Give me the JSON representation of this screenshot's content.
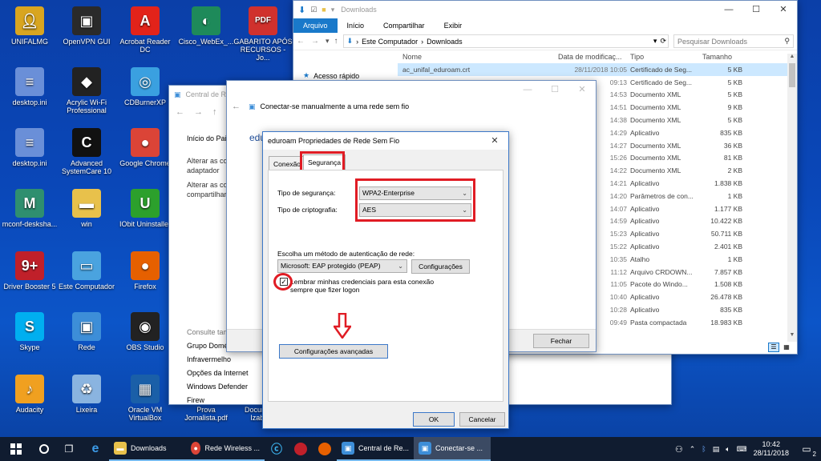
{
  "desktop_icons": [
    {
      "label": "UNIFALMG",
      "icon": "user-folder-icon",
      "color": "#d8a520"
    },
    {
      "label": "OpenVPN GUI",
      "icon": "openvpn-icon",
      "color": "#2a2a2a"
    },
    {
      "label": "Acrobat Reader DC",
      "icon": "acrobat-icon",
      "color": "#e2231a"
    },
    {
      "label": "Cisco_WebEx_...",
      "icon": "webex-icon",
      "color": "#1e8a5a"
    },
    {
      "label": "GABARITO APÓS RECURSOS - Jo...",
      "icon": "pdf-file-icon",
      "color": "#d0312d"
    },
    {
      "label": "desktop.ini",
      "icon": "ini-file-icon",
      "color": "#6a8fd8"
    },
    {
      "label": "Acrylic Wi-Fi Professional",
      "icon": "acrylic-wifi-icon",
      "color": "#222"
    },
    {
      "label": "CDBurnerXP",
      "icon": "cdburner-icon",
      "color": "#3aa0e0"
    },
    {
      "label": "desktop.ini",
      "icon": "ini-file-icon",
      "color": "#6a8fd8"
    },
    {
      "label": "Advanced SystemCare 10",
      "icon": "systemcare-icon",
      "color": "#111"
    },
    {
      "label": "Google Chrome",
      "icon": "chrome-icon",
      "color": "#db4437"
    },
    {
      "label": "mconf-desksha...",
      "icon": "mconf-icon",
      "color": "#2f8f6f"
    },
    {
      "label": "win",
      "icon": "folder-icon",
      "color": "#e8c14b"
    },
    {
      "label": "IObit Uninstaller",
      "icon": "iobit-icon",
      "color": "#2ca02c"
    },
    {
      "label": "Driver Booster 5",
      "icon": "driver-booster-icon",
      "color": "#c0202a"
    },
    {
      "label": "Este Computador",
      "icon": "computer-icon",
      "color": "#4aa3df"
    },
    {
      "label": "Firefox",
      "icon": "firefox-icon",
      "color": "#e66000"
    },
    {
      "label": "Skype",
      "icon": "skype-icon",
      "color": "#00aff0"
    },
    {
      "label": "Rede",
      "icon": "network-icon",
      "color": "#3d8ed8"
    },
    {
      "label": "OBS Studio",
      "icon": "obs-icon",
      "color": "#222"
    },
    {
      "label": "Audacity",
      "icon": "audacity-icon",
      "color": "#f0a020"
    },
    {
      "label": "Lixeira",
      "icon": "recycle-bin-icon",
      "color": "#8ab4e0"
    },
    {
      "label": "Oracle VM VirtualBox",
      "icon": "virtualbox-icon",
      "color": "#1a5fa8"
    },
    {
      "label": "Prova Jornalista.pdf",
      "icon": "pdf-file-icon",
      "color": "#d0312d"
    },
    {
      "label": "Documento Izabel...",
      "icon": "document-icon",
      "color": "#ddd"
    }
  ],
  "explorer": {
    "title": "Downloads",
    "tabs": [
      "Arquivo",
      "Início",
      "Compartilhar",
      "Exibir"
    ],
    "path": [
      "Este Computador",
      "Downloads"
    ],
    "search_placeholder": "Pesquisar Downloads",
    "columns": [
      "Nome",
      "Data de modificaç...",
      "Tipo",
      "Tamanho"
    ],
    "nav_quick_access": "Acesso rápido",
    "rows": [
      {
        "name": "ac_unifal_eduroam.crt",
        "date": "28/11/2018 10:05",
        "type": "Certificado de Seg...",
        "size": "5 KB"
      },
      {
        "name": "",
        "date": "09:13",
        "type": "Certificado de Seg...",
        "size": "5 KB"
      },
      {
        "name": "",
        "date": "14:53",
        "type": "Documento XML",
        "size": "5 KB"
      },
      {
        "name": "",
        "date": "14:51",
        "type": "Documento XML",
        "size": "9 KB"
      },
      {
        "name": "",
        "date": "14:38",
        "type": "Documento XML",
        "size": "5 KB"
      },
      {
        "name": "",
        "date": "14:29",
        "type": "Aplicativo",
        "size": "835 KB"
      },
      {
        "name": "",
        "date": "14:27",
        "type": "Documento XML",
        "size": "36 KB"
      },
      {
        "name": "",
        "date": "15:26",
        "type": "Documento XML",
        "size": "81 KB"
      },
      {
        "name": "",
        "date": "14:22",
        "type": "Documento XML",
        "size": "2 KB"
      },
      {
        "name": "",
        "date": "14:21",
        "type": "Aplicativo",
        "size": "1.838 KB"
      },
      {
        "name": "",
        "date": "14:20",
        "type": "Parâmetros de con...",
        "size": "1 KB"
      },
      {
        "name": "",
        "date": "14:07",
        "type": "Aplicativo",
        "size": "1.177 KB"
      },
      {
        "name": "",
        "date": "14:59",
        "type": "Aplicativo",
        "size": "10.422 KB"
      },
      {
        "name": "",
        "date": "15:23",
        "type": "Aplicativo",
        "size": "50.711 KB"
      },
      {
        "name": "",
        "date": "15:22",
        "type": "Aplicativo",
        "size": "2.401 KB"
      },
      {
        "name": "",
        "date": "10:35",
        "type": "Atalho",
        "size": "1 KB"
      },
      {
        "name": "",
        "date": "11:12",
        "type": "Arquivo CRDOWN...",
        "size": "7.857 KB"
      },
      {
        "name": "",
        "date": "11:05",
        "type": "Pacote do Windo...",
        "size": "1.508 KB"
      },
      {
        "name": "",
        "date": "10:40",
        "type": "Aplicativo",
        "size": "26.478 KB"
      },
      {
        "name": "",
        "date": "10:28",
        "type": "Aplicativo",
        "size": "835 KB"
      },
      {
        "name": "",
        "date": "09:49",
        "type": "Pasta compactada",
        "size": "18.983 KB"
      }
    ]
  },
  "control_panel": {
    "title": "Central de Rede",
    "links": [
      "Início do Pai",
      "Alterar as co adaptador",
      "Alterar as co compartilhar"
    ],
    "see_also": "Consulte tam",
    "bottom_links": [
      "Grupo Domé",
      "Infravermelho",
      "Opções da Internet",
      "Windows Defender Firew"
    ]
  },
  "wizard": {
    "title": "Conectar-se manualmente a uma rede sem fio",
    "partial_text": "edu",
    "close_label": "Fechar"
  },
  "dialog": {
    "title": "eduroam Propriedades de Rede Sem Fio",
    "tabs": [
      "Conexão",
      "Segurança"
    ],
    "security_type_label": "Tipo de segurança:",
    "security_type_value": "WPA2-Enterprise",
    "encryption_label": "Tipo de criptografia:",
    "encryption_value": "AES",
    "auth_label": "Escolha um método de autenticação de rede:",
    "auth_value": "Microsoft: EAP protegido (PEAP)",
    "settings_button": "Configurações",
    "remember_label": "Lembrar minhas credenciais para esta conexão",
    "remember_label_2": "sempre que fizer logon",
    "remember_checked": true,
    "advanced_button": "Configurações avançadas",
    "ok": "OK",
    "cancel": "Cancelar",
    "highlight_color": "#e01c24"
  },
  "taskbar": {
    "items": [
      {
        "label": "Downloads",
        "icon": "folder-icon",
        "color": "#e8c14b"
      },
      {
        "label": "Rede Wireless ...",
        "icon": "chrome-icon",
        "color": "#db4437"
      },
      {
        "label": "Central de Re...",
        "icon": "network-icon",
        "color": "#3d8ed8"
      },
      {
        "label": "Conectar-se ...",
        "icon": "network-icon",
        "color": "#3d8ed8"
      }
    ],
    "time": "10:42",
    "date": "28/11/2018",
    "notification_count": "2"
  }
}
